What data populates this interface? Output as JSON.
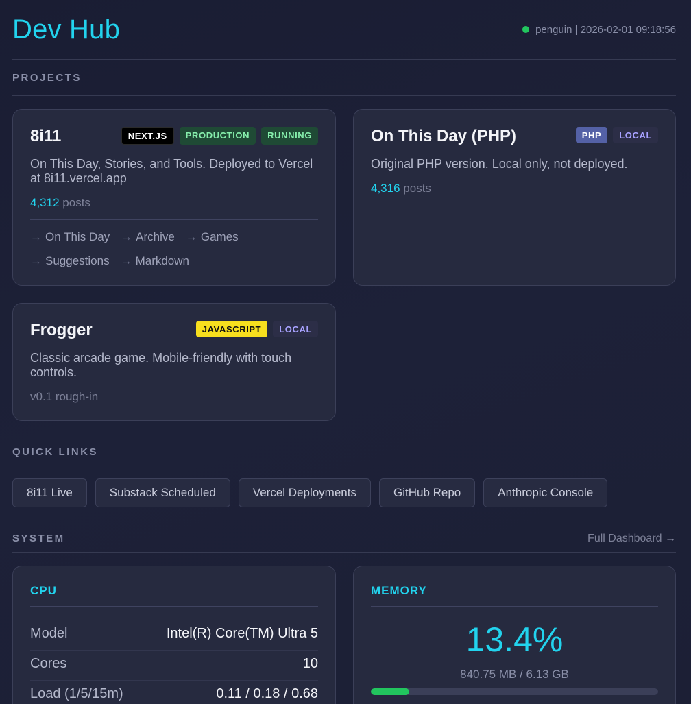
{
  "header": {
    "title": "Dev Hub",
    "status": "penguin | 2026-02-01 09:18:56",
    "status_color": "#22c55e"
  },
  "sections": {
    "projects": "PROJECTS",
    "quick_links": "QUICK LINKS",
    "system": "SYSTEM",
    "system_link": "Full Dashboard →"
  },
  "projects": [
    {
      "name": "8i11",
      "badges": [
        "NEXT.JS",
        "PRODUCTION",
        "RUNNING"
      ],
      "description": "On This Day, Stories, and Tools. Deployed to Vercel at 8i11.vercel.app",
      "posts_count": "4,312",
      "posts_label": "posts",
      "links": [
        "On This Day",
        "Archive",
        "Games",
        "Suggestions",
        "Markdown"
      ]
    },
    {
      "name": "On This Day (PHP)",
      "badges": [
        "PHP",
        "LOCAL"
      ],
      "description": "Original PHP version. Local only, not deployed.",
      "posts_count": "4,316",
      "posts_label": "posts"
    },
    {
      "name": "Frogger",
      "badges": [
        "JAVASCRIPT",
        "LOCAL"
      ],
      "description": "Classic arcade game. Mobile-friendly with touch controls.",
      "version": "v0.1 rough-in"
    }
  ],
  "quick_links": [
    "8i11 Live",
    "Substack Scheduled",
    "Vercel Deployments",
    "GitHub Repo",
    "Anthropic Console"
  ],
  "system": {
    "cpu": {
      "title": "CPU",
      "rows": [
        {
          "label": "Model",
          "value": "Intel(R) Core(TM) Ultra 5"
        },
        {
          "label": "Cores",
          "value": "10"
        },
        {
          "label": "Load (1/5/15m)",
          "value": "0.11 / 0.18 / 0.68"
        }
      ]
    },
    "memory": {
      "title": "MEMORY",
      "percent": "13.4%",
      "usage": "840.75 MB / 6.13 GB",
      "fill_percent": 13.4
    }
  }
}
